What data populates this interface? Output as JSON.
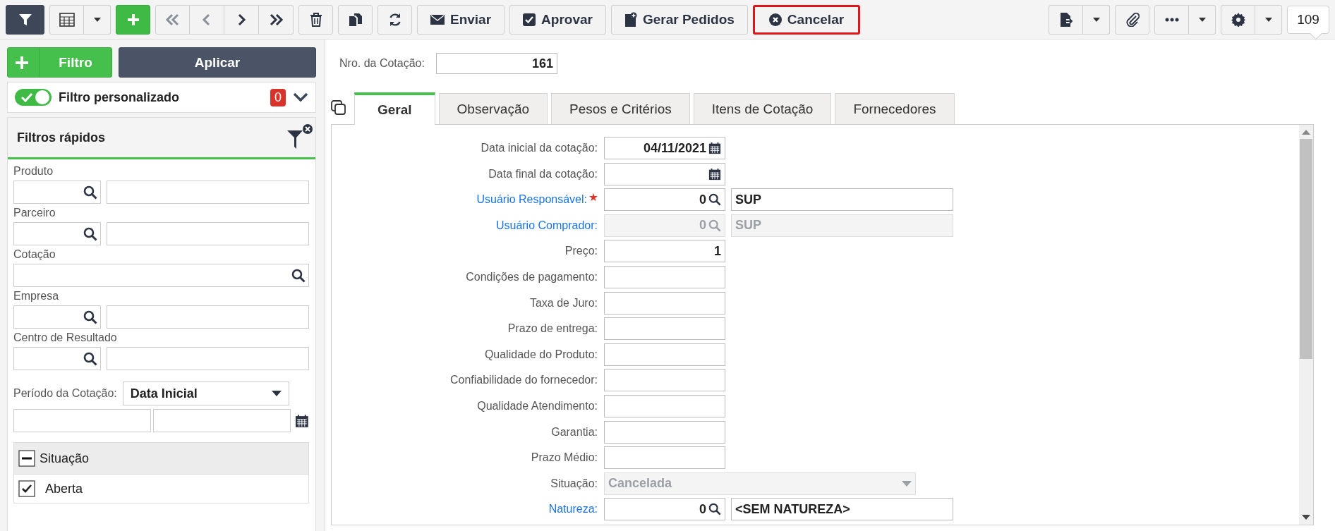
{
  "toolbar": {
    "nav_buttons": [
      {
        "kind": "first",
        "disabled": true
      },
      {
        "kind": "previous",
        "disabled": true
      },
      {
        "kind": "next",
        "disabled": false
      },
      {
        "kind": "last",
        "disabled": false
      }
    ],
    "actions": [
      {
        "kind": "send",
        "label": "Enviar",
        "highlighted": false
      },
      {
        "kind": "approve",
        "label": "Aprovar",
        "highlighted": false
      },
      {
        "kind": "generate",
        "label": "Gerar Pedidos",
        "highlighted": false
      },
      {
        "kind": "cancel",
        "label": "Cancelar",
        "highlighted": true
      }
    ],
    "counter": "109"
  },
  "filter_panel": {
    "add_filter_button": "Filtro",
    "apply_button": "Aplicar",
    "custom_filter": {
      "label": "Filtro personalizado",
      "on": true,
      "count": "0"
    },
    "quick_filters": {
      "title": "Filtros rápidos",
      "fields": [
        {
          "kind": "lookup",
          "label": "Produto"
        },
        {
          "kind": "lookup",
          "label": "Parceiro"
        },
        {
          "kind": "search",
          "label": "Cotação"
        },
        {
          "kind": "lookup",
          "label": "Empresa"
        },
        {
          "kind": "lookup",
          "label": "Centro de Resultado"
        }
      ],
      "period": {
        "label": "Período da Cotação:",
        "value": "Data Inicial"
      },
      "status_group": {
        "title": "Situação",
        "expanded": true,
        "options": [
          {
            "label": "Aberta",
            "checked": true
          }
        ]
      }
    }
  },
  "form": {
    "quote_number": {
      "label": "Nro. da Cotação:",
      "value": "161"
    },
    "tabs": [
      {
        "label": "Geral",
        "selected": true
      },
      {
        "label": "Observação",
        "selected": false
      },
      {
        "label": "Pesos e Critérios",
        "selected": false
      },
      {
        "label": "Itens de Cotação",
        "selected": false
      },
      {
        "label": "Fornecedores",
        "selected": false
      }
    ],
    "fields": [
      {
        "kind": "date",
        "label": "Data inicial da cotação:",
        "value": "04/11/2021",
        "link": false,
        "required": false,
        "disabled": false
      },
      {
        "kind": "date",
        "label": "Data final da cotação:",
        "link": false,
        "required": false,
        "disabled": false
      },
      {
        "kind": "lookup",
        "label": "Usuário Responsável:",
        "value": "0",
        "description": "SUP",
        "link": true,
        "required": true,
        "disabled": false
      },
      {
        "kind": "lookup",
        "label": "Usuário Comprador:",
        "value": "0",
        "description": "SUP",
        "link": true,
        "required": false,
        "disabled": true
      },
      {
        "kind": "text",
        "label": "Preço:",
        "value": "1",
        "link": false,
        "required": false,
        "disabled": false
      },
      {
        "kind": "text",
        "label": "Condições de pagamento:",
        "link": false,
        "required": false,
        "disabled": false
      },
      {
        "kind": "text",
        "label": "Taxa de Juro:",
        "link": false,
        "required": false,
        "disabled": false
      },
      {
        "kind": "text",
        "label": "Prazo de entrega:",
        "link": false,
        "required": false,
        "disabled": false
      },
      {
        "kind": "text",
        "label": "Qualidade do Produto:",
        "link": false,
        "required": false,
        "disabled": false
      },
      {
        "kind": "text",
        "label": "Confiabilidade do fornecedor:",
        "link": false,
        "required": false,
        "disabled": false
      },
      {
        "kind": "text",
        "label": "Qualidade Atendimento:",
        "link": false,
        "required": false,
        "disabled": false
      },
      {
        "kind": "text",
        "label": "Garantia:",
        "link": false,
        "required": false,
        "disabled": false
      },
      {
        "kind": "text",
        "label": "Prazo Médio:",
        "link": false,
        "required": false,
        "disabled": false
      },
      {
        "kind": "select",
        "label": "Situação:",
        "value": "Cancelada",
        "link": false,
        "required": false,
        "disabled": true
      },
      {
        "kind": "lookup",
        "label": "Natureza:",
        "value": "0",
        "description": "<SEM NATUREZA>",
        "link": true,
        "required": false,
        "disabled": false
      }
    ]
  }
}
